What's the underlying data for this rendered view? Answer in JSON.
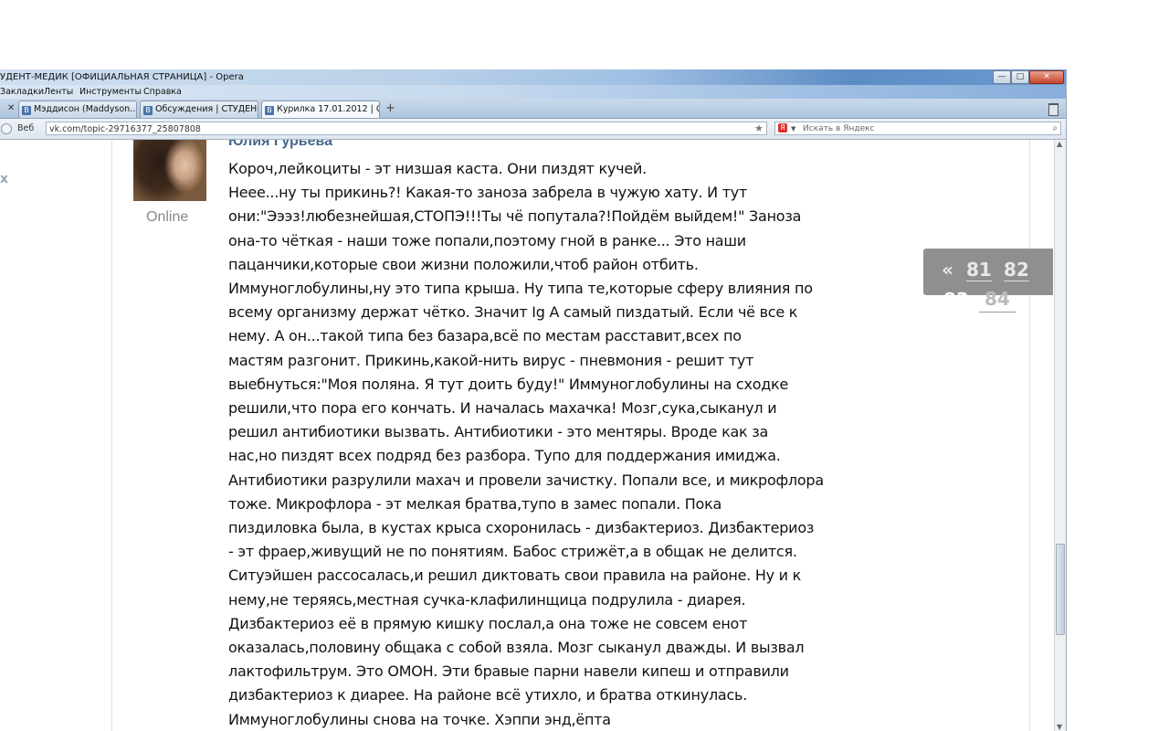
{
  "window": {
    "title": "УДЕНТ-МЕДИК [ОФИЦИАЛЬНАЯ СТРАНИЦА] - Opera",
    "min_label": "—",
    "max_label": "□",
    "close_label": "✕"
  },
  "menu": {
    "items": [
      "Закладки",
      "Ленты",
      "Инструменты",
      "Справка"
    ]
  },
  "tabs": [
    {
      "label": "Мэддисон (Maddyson..."
    },
    {
      "label": "Обсуждения | СТУДЕН..."
    },
    {
      "label": "Курилка 17.01.2012 | С..."
    }
  ],
  "tab_controls": {
    "close_glyph": "✕",
    "new_tab_glyph": "+"
  },
  "address": {
    "web_label": "Веб",
    "url": "vk.com/topic-29716377_25807808",
    "search_placeholder": "Искать в Яндекс",
    "yandex_glyph": "Я"
  },
  "post": {
    "author": "Юлия Гурьева",
    "status": "Online",
    "lines": [
      "Короч,лейкоциты - эт низшая каста. Они пиздят кучей.",
      "Неее...ну ты прикинь?! Какая-то заноза забрела в чужую хату. И тут",
      "они:\"Эээз!любезнейшая,СТОПЭ!!!Ты чё попутала?!Пойдём выйдем!\" Заноза",
      "она-то чёткая - наши тоже попали,поэтому гной в ранке... Это наши",
      "пацанчики,которые свои жизни положили,чтоб район отбить.",
      "Иммуноглобулины,ну это типа крыша. Ну типа те,которые сферу влияния по",
      "всему организму держат чётко. Значит Ig A самый пиздатый. Если чё все к",
      "нему. А он...такой типа без базара,всё по местам расставит,всех по",
      "мастям разгонит. Прикинь,какой-нить вирус - пневмония - решит тут",
      "выебнуться:\"Моя поляна. Я тут доить буду!\" Иммуноглобулины на сходке",
      "решили,что пора его кончать. И началась махачка! Мозг,сука,сыканул и",
      "решил антибиотики вызвать. Антибиотики - это ментяры. Вроде как за",
      "нас,но пиздят всех подряд без разбора. Тупо для поддержания имиджа.",
      "Антибиотики разрулили махач и провели зачистку. Попали все, и микрофлора",
      "тоже. Микрофлора - эт мелкая братва,тупо в замес попали. Пока",
      "пиздиловка была, в кустах крыса схоронилась - дизбактериоз. Дизбактериоз",
      "- эт фраер,живущий не по понятиям. Бабос стрижёт,а в общак не делится.",
      "Ситуэйшен рассосалась,и решил диктовать свои правила на районе. Ну и к",
      "нему,не теряясь,местная сучка-клафилинщица подрулила - диарея.",
      "Дизбактериоз её в прямую кишку послал,а она тоже не совсем енот",
      "оказалась,половину общака с собой взяла. Мозг сыканул дважды. И вызвал",
      "лактофильтрум. Это ОМОН. Эти бравые парни навели кипеш и отправили",
      "дизбактериоз к диарее. На районе всё утихло, и братва откинулась.",
      "Иммуноглобулины снова на точке. Хэппи энд,ёпта"
    ]
  },
  "pager": {
    "prev": "«",
    "page_a": "81",
    "page_b": "82",
    "page_c": "83",
    "page_d": "84"
  },
  "sidebar": {
    "fragment": "x"
  },
  "colors": {
    "author": "#45688e",
    "pager_bg": "#8a8a8a",
    "titlebar_accent": "#5b8cc4"
  }
}
